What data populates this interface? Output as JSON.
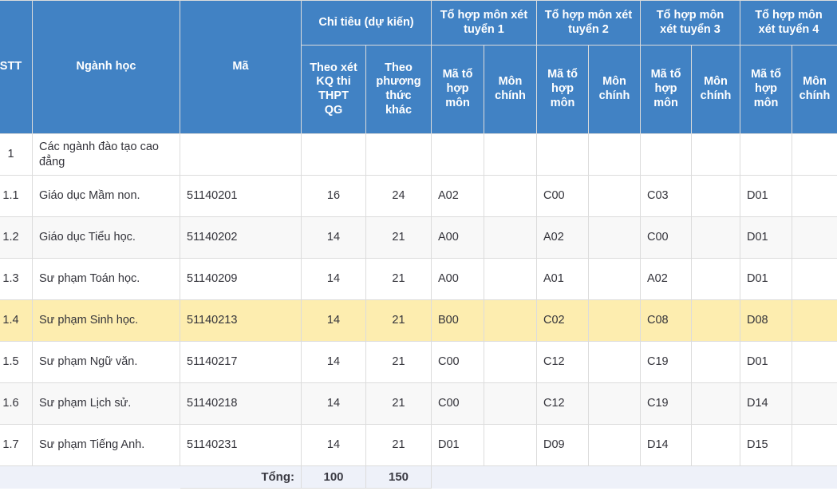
{
  "colors": {
    "header_blue": "#4182c4",
    "row_highlight": "#fdedaf",
    "row_stripe": "#f8f8f8",
    "total_row_bg": "#eef1f9",
    "grid_line": "#dcdcdc",
    "text": "#33333a"
  },
  "header": {
    "stt": "STT",
    "nganh_hoc": "Ngành học",
    "ma": "Mã",
    "chi_tieu_group": "Chỉ tiêu (dự kiến)",
    "chi_tieu_sub": [
      "Theo xét KQ thi THPT QG",
      "Theo phương thức khác"
    ],
    "to_hop_groups": [
      "Tổ hợp môn xét tuyển 1",
      "Tổ hợp môn xét tuyển 2",
      "Tổ hợp môn xét tuyển 3",
      "Tổ hợp môn xét tuyển 4"
    ],
    "to_hop_sub": {
      "ma_to_hop_mon": "Mã tổ hợp môn",
      "mon_chinh": "Môn chính"
    }
  },
  "rows": [
    {
      "stt": "1",
      "nganh_hoc": "Các ngành đào tạo cao đẳng",
      "ma": "",
      "quota_thpt": "",
      "quota_khac": "",
      "comb1_code": "",
      "comb1_main": "",
      "comb2_code": "",
      "comb2_main": "",
      "comb3_code": "",
      "comb3_main": "",
      "comb4_code": "",
      "comb4_main": "",
      "style": "group"
    },
    {
      "stt": "1.1",
      "nganh_hoc": "Giáo dục Mầm non.",
      "ma": "51140201",
      "quota_thpt": "16",
      "quota_khac": "24",
      "comb1_code": "A02",
      "comb1_main": "",
      "comb2_code": "C00",
      "comb2_main": "",
      "comb3_code": "C03",
      "comb3_main": "",
      "comb4_code": "D01",
      "comb4_main": "",
      "style": "plain"
    },
    {
      "stt": "1.2",
      "nganh_hoc": "Giáo dục Tiểu học.",
      "ma": "51140202",
      "quota_thpt": "14",
      "quota_khac": "21",
      "comb1_code": "A00",
      "comb1_main": "",
      "comb2_code": "A02",
      "comb2_main": "",
      "comb3_code": "C00",
      "comb3_main": "",
      "comb4_code": "D01",
      "comb4_main": "",
      "style": "striped"
    },
    {
      "stt": "1.3",
      "nganh_hoc": "Sư phạm Toán học.",
      "ma": "51140209",
      "quota_thpt": "14",
      "quota_khac": "21",
      "comb1_code": "A00",
      "comb1_main": "",
      "comb2_code": "A01",
      "comb2_main": "",
      "comb3_code": "A02",
      "comb3_main": "",
      "comb4_code": "D01",
      "comb4_main": "",
      "style": "plain"
    },
    {
      "stt": "1.4",
      "nganh_hoc": "Sư phạm Sinh học.",
      "ma": "51140213",
      "quota_thpt": "14",
      "quota_khac": "21",
      "comb1_code": "B00",
      "comb1_main": "",
      "comb2_code": "C02",
      "comb2_main": "",
      "comb3_code": "C08",
      "comb3_main": "",
      "comb4_code": "D08",
      "comb4_main": "",
      "style": "highlight"
    },
    {
      "stt": "1.5",
      "nganh_hoc": "Sư phạm Ngữ văn.",
      "ma": "51140217",
      "quota_thpt": "14",
      "quota_khac": "21",
      "comb1_code": "C00",
      "comb1_main": "",
      "comb2_code": "C12",
      "comb2_main": "",
      "comb3_code": "C19",
      "comb3_main": "",
      "comb4_code": "D01",
      "comb4_main": "",
      "style": "plain"
    },
    {
      "stt": "1.6",
      "nganh_hoc": "Sư phạm Lịch sử.",
      "ma": "51140218",
      "quota_thpt": "14",
      "quota_khac": "21",
      "comb1_code": "C00",
      "comb1_main": "",
      "comb2_code": "C12",
      "comb2_main": "",
      "comb3_code": "C19",
      "comb3_main": "",
      "comb4_code": "D14",
      "comb4_main": "",
      "style": "striped"
    },
    {
      "stt": "1.7",
      "nganh_hoc": "Sư phạm Tiếng Anh.",
      "ma": "51140231",
      "quota_thpt": "14",
      "quota_khac": "21",
      "comb1_code": "D01",
      "comb1_main": "",
      "comb2_code": "D09",
      "comb2_main": "",
      "comb3_code": "D14",
      "comb3_main": "",
      "comb4_code": "D15",
      "comb4_main": "",
      "style": "plain"
    }
  ],
  "total": {
    "label": "Tổng:",
    "quota_thpt": "100",
    "quota_khac": "150"
  }
}
